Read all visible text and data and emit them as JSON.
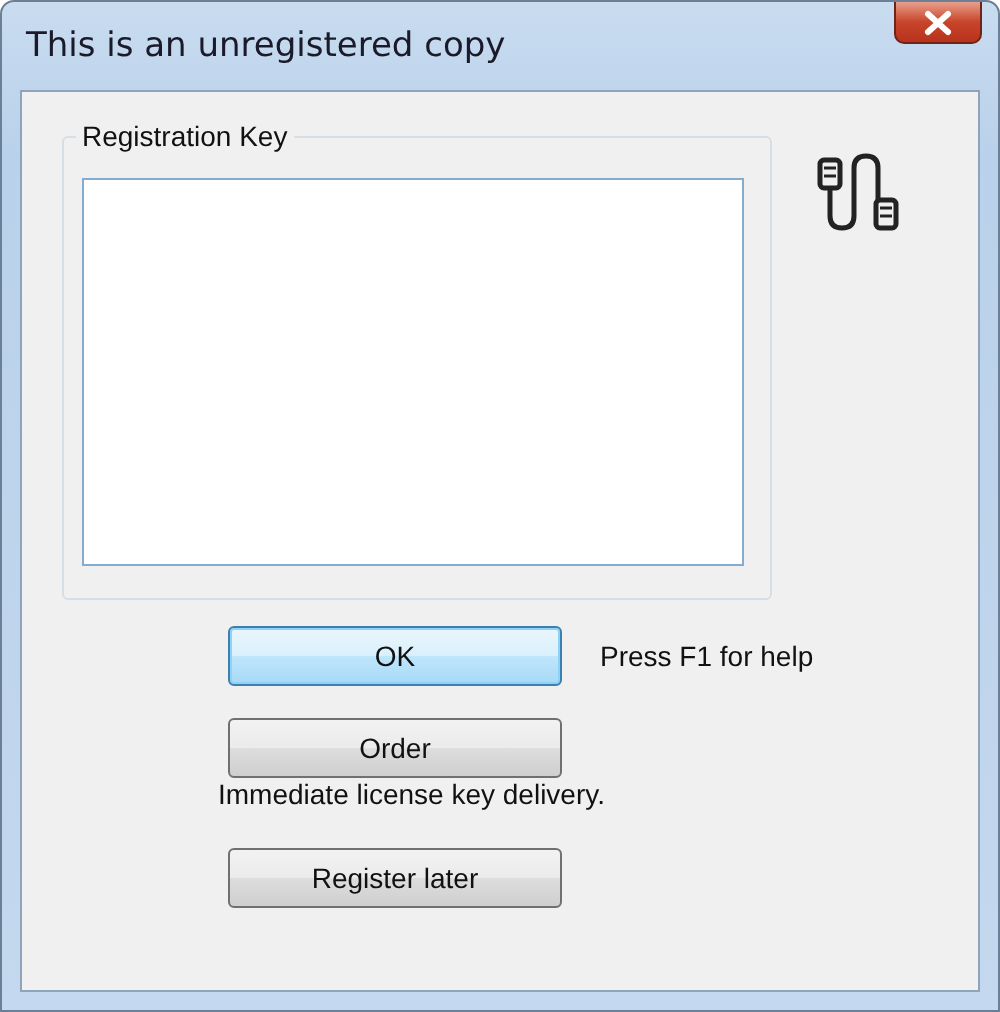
{
  "window": {
    "title": "This is an unregistered copy"
  },
  "registration": {
    "label": "Registration Key"
  },
  "actions": [
    {
      "label": "OK",
      "default": true,
      "note": "Press F1 for help",
      "kind": "beside"
    },
    {
      "label": "Order",
      "default": false,
      "note": "Immediate license key delivery.",
      "kind": "below"
    },
    {
      "label": "Register later",
      "default": false,
      "kind": "plain"
    }
  ]
}
